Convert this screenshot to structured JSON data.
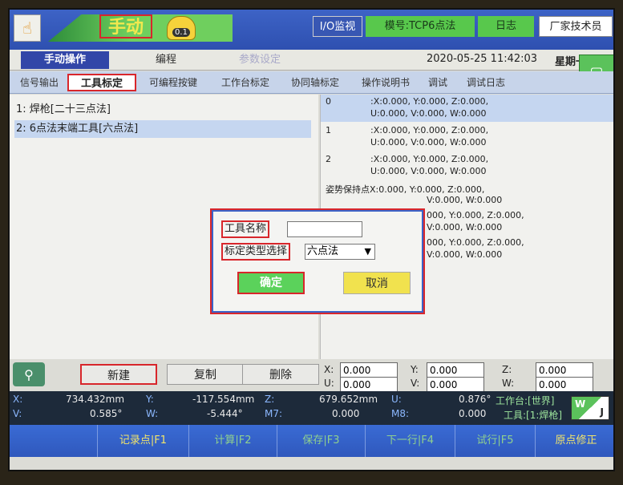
{
  "topbar": {
    "mode": "手动",
    "speed": "0.1",
    "io_monitor": "I/O监视",
    "model": "模号:TCP6点法",
    "log": "日志",
    "vendor": "厂家技术员"
  },
  "subbar": {
    "manual_op": "手动操作",
    "programming": "编程",
    "param_setting": "参数设定",
    "datetime": "2020-05-25 11:42:03",
    "weekday": "星期一"
  },
  "tabs": [
    "信号输出",
    "工具标定",
    "可编程按键",
    "工作台标定",
    "协同轴标定",
    "操作说明书",
    "调试",
    "调试日志"
  ],
  "tool_list": [
    "1: 焊枪[二十三点法]",
    "2: 6点法末端工具[六点法]"
  ],
  "points": [
    {
      "idx": "0",
      "l1": ":X:0.000, Y:0.000, Z:0.000,",
      "l2": "U:0.000, V:0.000, W:0.000"
    },
    {
      "idx": "1",
      "l1": ":X:0.000, Y:0.000, Z:0.000,",
      "l2": "U:0.000, V:0.000, W:0.000"
    },
    {
      "idx": "2",
      "l1": ":X:0.000, Y:0.000, Z:0.000,",
      "l2": "U:0.000, V:0.000, W:0.000"
    },
    {
      "idx": "",
      "l1": "姿势保持点X:0.000, Y:0.000, Z:0.000,",
      "l2": "V:0.000, W:0.000"
    },
    {
      "idx": "",
      "l1": "000, Y:0.000, Z:0.000,",
      "l2": "V:0.000, W:0.000"
    },
    {
      "idx": "",
      "l1": "000, Y:0.000, Z:0.000,",
      "l2": "V:0.000, W:0.000"
    }
  ],
  "dialog": {
    "tool_name_label": "工具名称",
    "tool_name_value": "",
    "calib_type_label": "标定类型选择",
    "calib_type_value": "六点法",
    "ok": "确定",
    "cancel": "取消"
  },
  "actions": {
    "new": "新建",
    "copy": "复制",
    "delete": "删除"
  },
  "coords": {
    "x_label": "X:",
    "x": "0.000",
    "y_label": "Y:",
    "y": "0.000",
    "z_label": "Z:",
    "z": "0.000",
    "u_label": "U:",
    "u": "0.000",
    "v_label": "V:",
    "v": "0.000",
    "w_label": "W:",
    "w": "0.000"
  },
  "status": {
    "x": "X:",
    "x_val": "734.432mm",
    "y": "Y:",
    "y_val": "-117.554mm",
    "z": "Z:",
    "z_val": "679.652mm",
    "u": "U:",
    "u_val": "0.876°",
    "v": "V:",
    "v_val": "0.585°",
    "w": "W:",
    "w_val": "-5.444°",
    "m7": "M7:",
    "m7_val": "0.000",
    "m8": "M8:",
    "m8_val": "0.000",
    "workbench": "工作台:[世界]",
    "tool": "工具:[1:焊枪]",
    "badge_w": "W",
    "badge_j": "J"
  },
  "fkeys": [
    "记录点|F1",
    "计算|F2",
    "保存|F3",
    "下一行|F4",
    "试行|F5",
    "原点修正"
  ]
}
